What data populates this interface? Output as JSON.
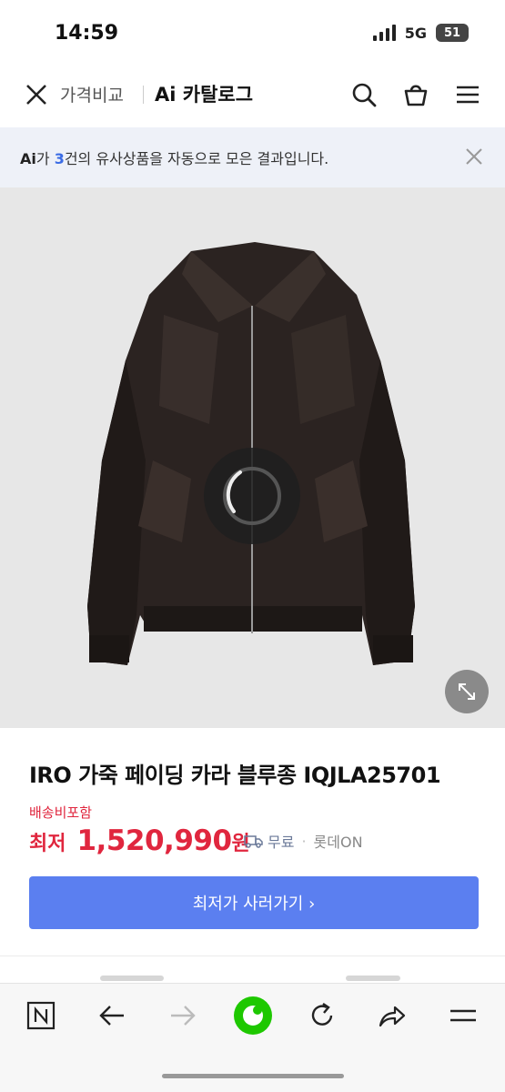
{
  "status_bar": {
    "time": "14:59",
    "network": "5G",
    "battery": "51"
  },
  "header": {
    "back_label": "가격비교",
    "title": "Ai 카탈로그"
  },
  "banner": {
    "prefix": "Ai",
    "text_a": "가 ",
    "count": "3",
    "text_b": "건의 유사상품을 자동으로 모은 결과입니다."
  },
  "product": {
    "name": "IRO 가죽 페이딩 카라 블루종 IQJLA25701",
    "shipping": "배송비포함",
    "price_prefix": "최저",
    "price": "1,520,990",
    "price_unit": "원",
    "delivery": "무료",
    "store": "롯데ON"
  },
  "buy_button": {
    "label": "최저가 사러가기 ›"
  },
  "colors": {
    "accent": "#5b7ff0",
    "price": "#e0263e",
    "highlight": "#3b6ce5",
    "naver_green": "#1ec800"
  },
  "icons": [
    "close-icon",
    "search-icon",
    "cart-icon",
    "menu-icon",
    "expand-icon",
    "naver-icon",
    "back-arrow-icon",
    "forward-arrow-icon",
    "refresh-icon",
    "share-icon"
  ]
}
